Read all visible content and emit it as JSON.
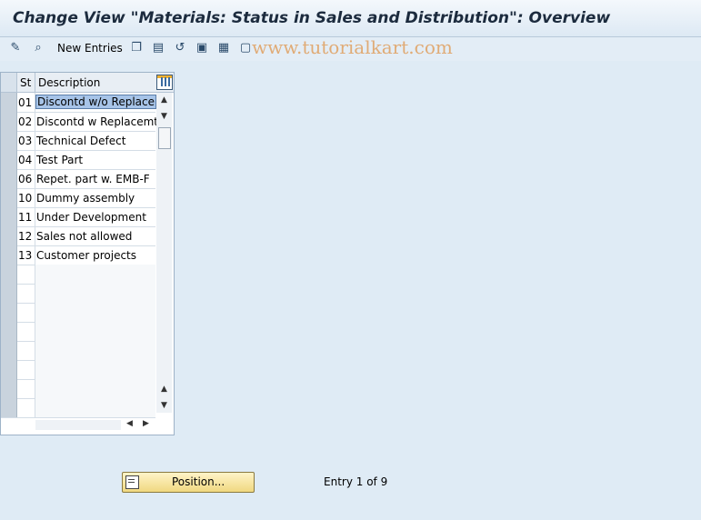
{
  "window": {
    "title": "Change View \"Materials: Status in Sales and Distribution\": Overview"
  },
  "toolbar": {
    "new_entries_label": "New Entries",
    "icons": [
      "display-change-icon",
      "other-view-icon",
      "copy-icon",
      "delete-icon",
      "undo-icon",
      "select-all-icon",
      "select-block-icon",
      "deselect-all-icon"
    ]
  },
  "watermark": "www.tutorialkart.com",
  "table": {
    "columns": [
      "St",
      "Description"
    ],
    "rows": [
      {
        "st": "01",
        "description": "Discontd w/o Replace"
      },
      {
        "st": "02",
        "description": "Discontd w Replacemt"
      },
      {
        "st": "03",
        "description": "Technical Defect"
      },
      {
        "st": "04",
        "description": "Test Part"
      },
      {
        "st": "06",
        "description": "Repet. part w. EMB-F"
      },
      {
        "st": "10",
        "description": "Dummy assembly"
      },
      {
        "st": "11",
        "description": "Under Development"
      },
      {
        "st": "12",
        "description": "Sales not allowed"
      },
      {
        "st": "13",
        "description": "Customer projects"
      }
    ]
  },
  "footer": {
    "position_button": "Position...",
    "entry_text": "Entry 1 of 9"
  }
}
